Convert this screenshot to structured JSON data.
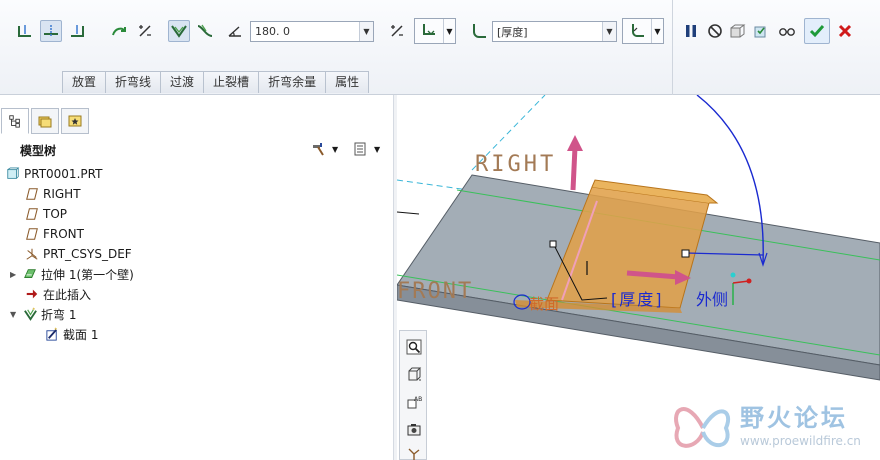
{
  "toolbar": {
    "angle_value": "180. 0",
    "type_value": "[厚度]",
    "tabs": [
      "放置",
      "折弯线",
      "过渡",
      "止裂槽",
      "折弯余量",
      "属性"
    ]
  },
  "panel": {
    "tree_title": "模型树",
    "items": [
      {
        "label": "PRT0001.PRT",
        "icon": "part-icon"
      },
      {
        "label": "RIGHT",
        "icon": "datum-plane-icon"
      },
      {
        "label": "TOP",
        "icon": "datum-plane-icon"
      },
      {
        "label": "FRONT",
        "icon": "datum-plane-icon"
      },
      {
        "label": "PRT_CSYS_DEF",
        "icon": "csys-icon"
      },
      {
        "label": "拉伸 1(第一个壁)",
        "icon": "wall-feature-icon"
      },
      {
        "label": "在此插入",
        "icon": "insert-here-arrow-icon"
      },
      {
        "label": "折弯 1",
        "icon": "bend-feature-icon"
      },
      {
        "label": "截面 1",
        "icon": "sketch-section-icon"
      }
    ]
  },
  "viewport": {
    "labels": {
      "right": "RIGHT",
      "front": "FRONT",
      "section": "截面",
      "thickness": "[厚度]",
      "outside": "外侧"
    },
    "colors": {
      "plate_top": "#a3adb6",
      "plate_side": "#868f99",
      "bend": "#e0a04a",
      "datum": "#a37a55",
      "dim": "#1a2ad0",
      "arrow": "#d0548a"
    }
  },
  "watermark": {
    "name": "野火论坛",
    "url": "www.proewildfire.cn"
  }
}
